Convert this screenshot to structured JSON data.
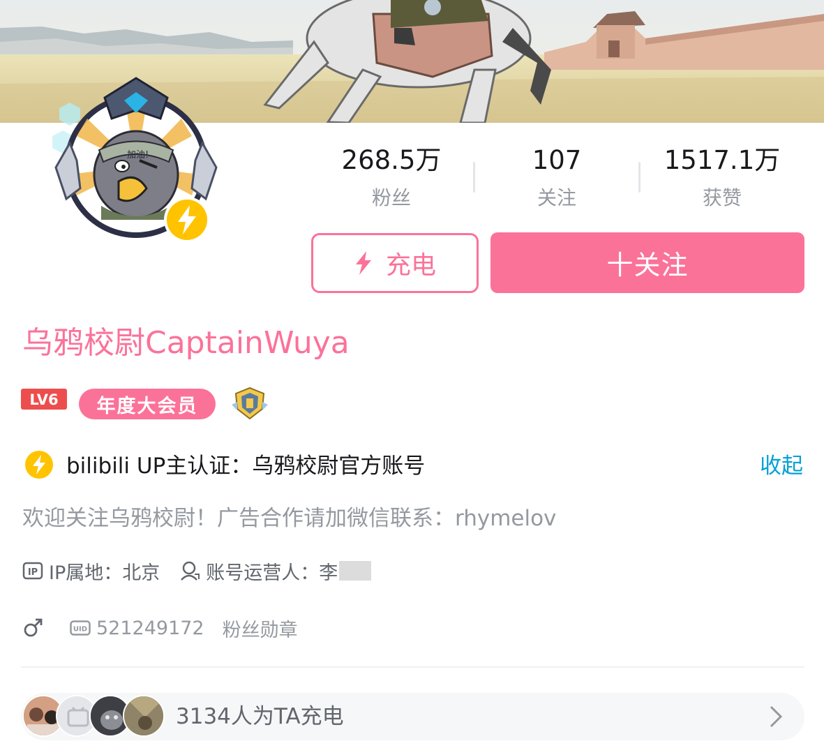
{
  "profile": {
    "username": "乌鸦校尉CaptainWuya",
    "level": "LV6",
    "vip_label": "年度大会员",
    "verify_text": "bilibili UP主认证：乌鸦校尉官方账号",
    "collapse_label": "收起",
    "bio": "欢迎关注乌鸦校尉！广告合作请加微信联系：rhymelov",
    "ip_text": "IP属地：北京",
    "operator_text": "账号运营人：李",
    "uid": "521249172",
    "fan_medal_label": "粉丝勋章"
  },
  "stats": [
    {
      "value": "268.5万",
      "label": "粉丝"
    },
    {
      "value": "107",
      "label": "关注"
    },
    {
      "value": "1517.1万",
      "label": "获赞"
    }
  ],
  "actions": {
    "charge_label": "充电",
    "follow_label": "十关注"
  },
  "charge_bar": {
    "text": "3134人为TA充电"
  },
  "colors": {
    "accent_pink": "#fb7299",
    "link_blue": "#00a1d6",
    "gray_text": "#9499a0",
    "dark_text": "#18191c"
  },
  "icons": [
    "lightning-icon",
    "ip-icon",
    "operator-icon",
    "male-icon",
    "uid-icon",
    "chevron-right-icon",
    "medal-icon"
  ]
}
